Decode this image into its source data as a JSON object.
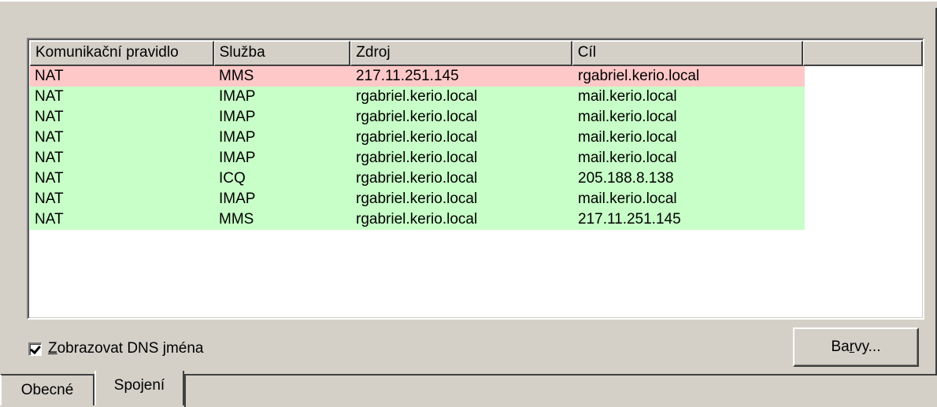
{
  "listview": {
    "columns": [
      "Komunikační pravidlo",
      "Služba",
      "Zdroj",
      "Cíl",
      ""
    ],
    "rows": [
      {
        "rule": "NAT",
        "service": "MMS",
        "source": "217.11.251.145",
        "target": "rgabriel.kerio.local",
        "status": "red"
      },
      {
        "rule": "NAT",
        "service": "IMAP",
        "source": "rgabriel.kerio.local",
        "target": "mail.kerio.local",
        "status": "green"
      },
      {
        "rule": "NAT",
        "service": "IMAP",
        "source": "rgabriel.kerio.local",
        "target": "mail.kerio.local",
        "status": "green"
      },
      {
        "rule": "NAT",
        "service": "IMAP",
        "source": "rgabriel.kerio.local",
        "target": "mail.kerio.local",
        "status": "green"
      },
      {
        "rule": "NAT",
        "service": "IMAP",
        "source": "rgabriel.kerio.local",
        "target": "mail.kerio.local",
        "status": "green"
      },
      {
        "rule": "NAT",
        "service": "ICQ",
        "source": "rgabriel.kerio.local",
        "target": "205.188.8.138",
        "status": "green"
      },
      {
        "rule": "NAT",
        "service": "IMAP",
        "source": "rgabriel.kerio.local",
        "target": "mail.kerio.local",
        "status": "green"
      },
      {
        "rule": "NAT",
        "service": "MMS",
        "source": "rgabriel.kerio.local",
        "target": "217.11.251.145",
        "status": "green"
      }
    ],
    "colors": {
      "red": "#ffc8c8",
      "green": "#c8ffc8"
    }
  },
  "dns_checkbox": {
    "checked": true,
    "mnemonic": "Z",
    "label_rest": "obrazovat DNS jména"
  },
  "colors_button": {
    "before": "Ba",
    "mnemonic": "r",
    "after": "vy..."
  },
  "tabs": [
    {
      "label": "Obecné",
      "active": false
    },
    {
      "label": "Spojení",
      "active": true
    }
  ]
}
